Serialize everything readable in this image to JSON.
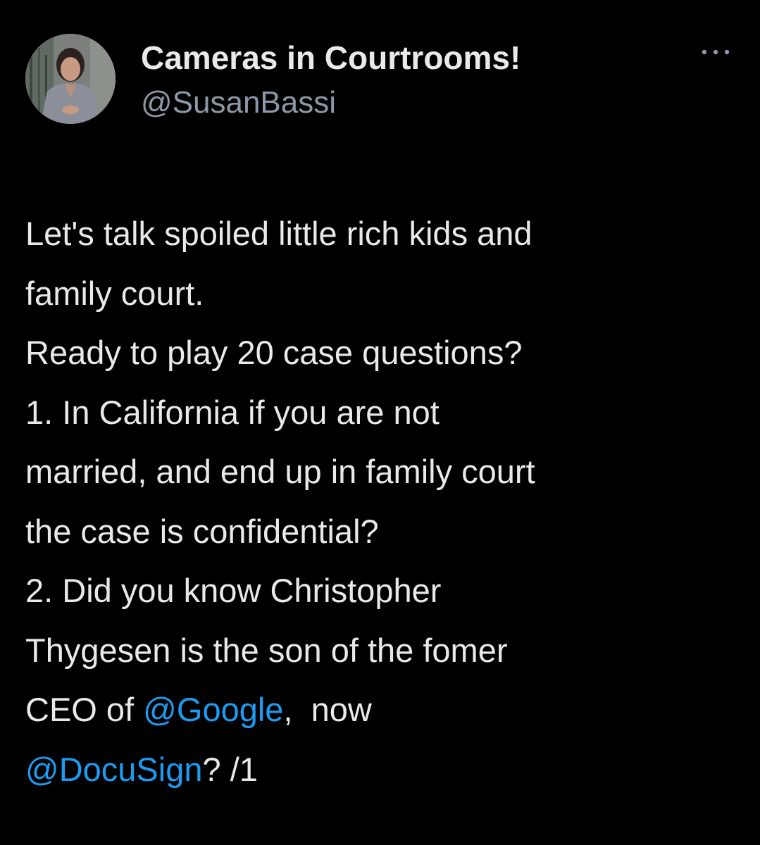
{
  "tweet": {
    "author": {
      "display_name": "Cameras in Courtrooms!",
      "handle": "@SusanBassi",
      "avatar_icon": "user-avatar-photo"
    },
    "more_icon": "more-horizontal-icon",
    "body": {
      "line1": "Let's talk spoiled little rich kids and",
      "line2": "family court.",
      "line3": "Ready to play 20 case questions?",
      "line4": "1. In California if you are not",
      "line5": "married, and end up in family court",
      "line6": "the case is confidential?",
      "line7": "2. Did you know Christopher",
      "line8": "Thygesen is the son of the fomer",
      "line9_prefix": "CEO of ",
      "mention_google": "@Google",
      "line9_suffix": ",  now",
      "mention_docusign": "@DocuSign",
      "line10_suffix": "? /1"
    }
  },
  "colors": {
    "background": "#000000",
    "text_primary": "#e7e9ea",
    "text_secondary": "#8b98a5",
    "link": "#1d9bf0"
  }
}
